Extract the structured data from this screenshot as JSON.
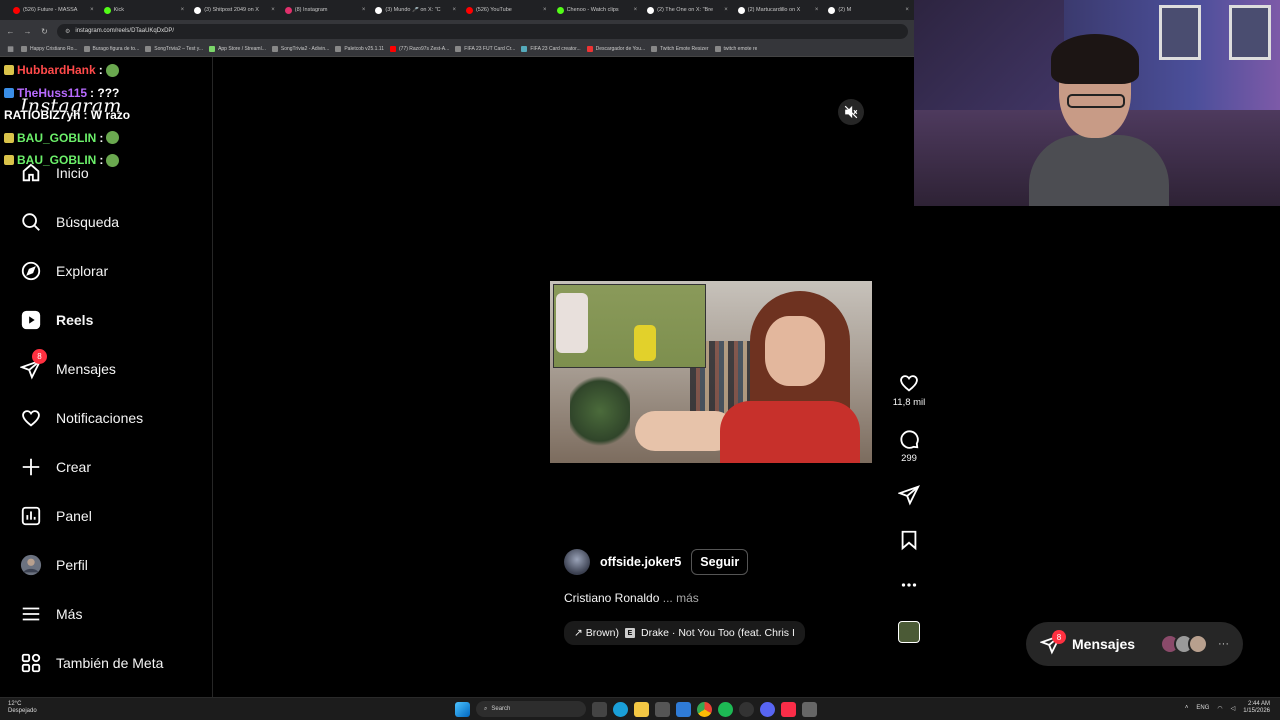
{
  "browser": {
    "tabs": [
      {
        "label": "(526) Future - MASSA",
        "color": "#ff0000"
      },
      {
        "label": "Kick",
        "color": "#53fc18"
      },
      {
        "label": "(3) Shitpost 2049 on X",
        "color": "#ffffff"
      },
      {
        "label": "(8) Instagram",
        "color": "#e1306c"
      },
      {
        "label": "(3) Mundo 🎤 on X: \"C",
        "color": "#ffffff"
      },
      {
        "label": "(526) YouTube",
        "color": "#ff0000"
      },
      {
        "label": "Chenoo - Watch clips",
        "color": "#53fc18"
      },
      {
        "label": "(2) The One on X: \"Bre",
        "color": "#ffffff"
      },
      {
        "label": "(2) Martucardillo on X",
        "color": "#ffffff"
      },
      {
        "label": "(2) M",
        "color": "#ffffff"
      }
    ],
    "url": "instagram.com/reels/DTaaUKqDxDP/",
    "bookmarks": [
      {
        "label": "Happy Cristiano Ro...",
        "color": "#888"
      },
      {
        "label": "Burago figura de to...",
        "color": "#888"
      },
      {
        "label": "SongTrivia2 – Test y...",
        "color": "#888"
      },
      {
        "label": "App Store / Streaml...",
        "color": "#7bd66a"
      },
      {
        "label": "SongTrivia2 - Adivin...",
        "color": "#888"
      },
      {
        "label": "Paletcob v25.1.11",
        "color": "#888"
      },
      {
        "label": "(77) Razo97s Zest-A...",
        "color": "#ff0000"
      },
      {
        "label": "FIFA 23 FUT Card Cr...",
        "color": "#888"
      },
      {
        "label": "FIFA 23 Card creator...",
        "color": "#5ab"
      },
      {
        "label": "Descargador de You...",
        "color": "#e33"
      },
      {
        "label": "Twitch Emote Resizer",
        "color": "#888"
      },
      {
        "label": "twitch emote re",
        "color": "#888"
      }
    ]
  },
  "chat": [
    {
      "user": "HubbardHank",
      "color": "#ff4a4a",
      "text": ":",
      "emote": true,
      "badge": "#d9c34a"
    },
    {
      "user": "TheHuss115",
      "color": "#b86bff",
      "text": ": ???",
      "emote": false,
      "badge": "#3a8ee6"
    },
    {
      "user": "RATIOBIZ7yh",
      "color": "#ffffff",
      "text": ": W razo",
      "emote": false,
      "badge": ""
    },
    {
      "user": "BAU_GOBLIN",
      "color": "#6cf06a",
      "text": ":",
      "emote": true,
      "badge": "#d9c34a"
    },
    {
      "user": "BAU_GOBLIN",
      "color": "#6cf06a",
      "text": ":",
      "emote": true,
      "badge": "#d9c34a"
    }
  ],
  "instagram": {
    "logo": "Instagram",
    "nav": [
      {
        "label": "Inicio",
        "icon": "home-icon"
      },
      {
        "label": "Búsqueda",
        "icon": "search-icon"
      },
      {
        "label": "Explorar",
        "icon": "explore-icon"
      },
      {
        "label": "Reels",
        "icon": "reels-icon"
      },
      {
        "label": "Mensajes",
        "icon": "messages-icon"
      },
      {
        "label": "Notificaciones",
        "icon": "heart-icon"
      },
      {
        "label": "Crear",
        "icon": "plus-icon"
      },
      {
        "label": "Panel",
        "icon": "dashboard-icon"
      },
      {
        "label": "Perfil",
        "icon": "avatar"
      },
      {
        "label": "Más",
        "icon": "menu-icon"
      },
      {
        "label": "También de Meta",
        "icon": "meta-icon"
      }
    ],
    "messages_badge": "8",
    "reel": {
      "author": "offside.joker5",
      "follow": "Seguir",
      "caption": "Cristiano Ronaldo",
      "more": "... más",
      "audio_prefix": "↗ Brown)",
      "audio_explicit": "E",
      "audio_track": "Drake · Not You Too (feat. Chris I"
    },
    "actions": {
      "likes": "11,8 mil",
      "comments": "299"
    },
    "messages_popup": {
      "label": "Mensajes",
      "badge": "8"
    }
  },
  "taskbar": {
    "weather_temp": "12°C",
    "weather_desc": "Despejado",
    "search": "Search",
    "lang": "ENG",
    "time": "2:44 AM",
    "date": "1/15/2026"
  }
}
